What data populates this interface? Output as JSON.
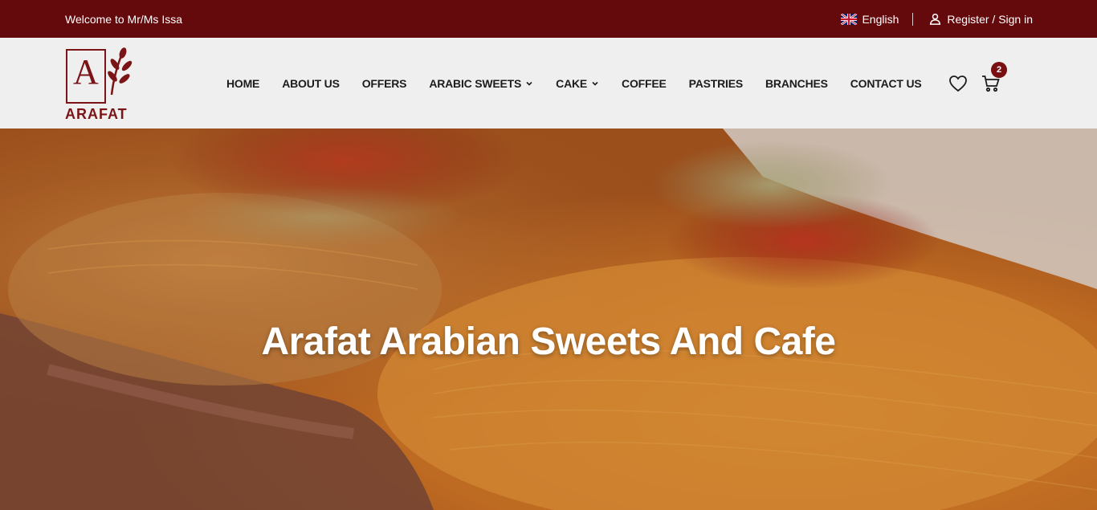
{
  "topbar": {
    "welcome": "Welcome to Mr/Ms Issa",
    "language": "English",
    "account_link": "Register / Sign in"
  },
  "brand": {
    "logo_letter": "A",
    "name": "ARAFAT"
  },
  "nav": {
    "items": [
      {
        "label": "HOME",
        "has_dropdown": false
      },
      {
        "label": "ABOUT US",
        "has_dropdown": false
      },
      {
        "label": "OFFERS",
        "has_dropdown": false
      },
      {
        "label": "ARABIC SWEETS",
        "has_dropdown": true
      },
      {
        "label": "CAKE",
        "has_dropdown": true
      },
      {
        "label": "COFFEE",
        "has_dropdown": false
      },
      {
        "label": "PASTRIES",
        "has_dropdown": false
      },
      {
        "label": "BRANCHES",
        "has_dropdown": false
      },
      {
        "label": "CONTACT US",
        "has_dropdown": false
      }
    ],
    "dropdown_glyph": "⌄"
  },
  "cart": {
    "count": "2"
  },
  "hero": {
    "title": "Arafat Arabian Sweets And Cafe"
  },
  "icons": {
    "flag": "uk-flag-icon",
    "user": "user-icon",
    "wishlist": "heart-icon",
    "cart": "cart-icon"
  },
  "colors": {
    "brand": "#650a0c",
    "logo": "#7a1416",
    "header_bg": "#efefef",
    "badge": "#7a0f12"
  }
}
